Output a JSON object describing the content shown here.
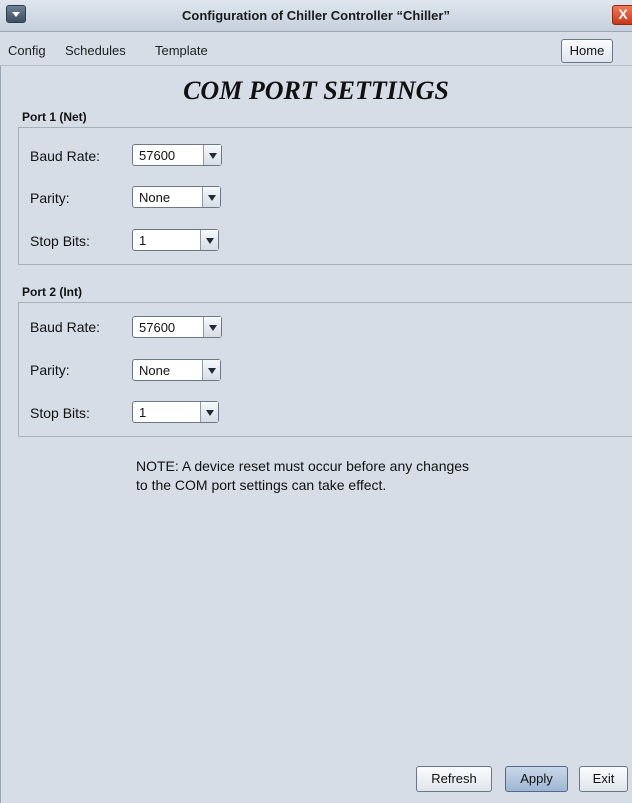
{
  "window": {
    "title": "Configuration of Chiller Controller “Chiller”",
    "close_label": "X"
  },
  "menu": {
    "items": [
      "Config",
      "Schedules",
      "Template"
    ],
    "home_label": "Home"
  },
  "page_title": "COM PORT SETTINGS",
  "ports": [
    {
      "label": "Port 1 (Net)",
      "baud_label": "Baud Rate:",
      "baud_value": "57600",
      "parity_label": "Parity:",
      "parity_value": "None",
      "stop_label": "Stop Bits:",
      "stop_value": "1"
    },
    {
      "label": "Port 2 (Int)",
      "baud_label": "Baud Rate:",
      "baud_value": "57600",
      "parity_label": "Parity:",
      "parity_value": "None",
      "stop_label": "Stop Bits:",
      "stop_value": "1"
    }
  ],
  "note": {
    "line1": "NOTE: A device reset must occur before any changes",
    "line2": "to the COM port settings can take effect."
  },
  "buttons": {
    "refresh": "Refresh",
    "apply": "Apply",
    "exit": "Exit"
  },
  "colors": {
    "background": "#d6dde6",
    "close": "#d9452a",
    "apply": "#a9bfd9"
  }
}
